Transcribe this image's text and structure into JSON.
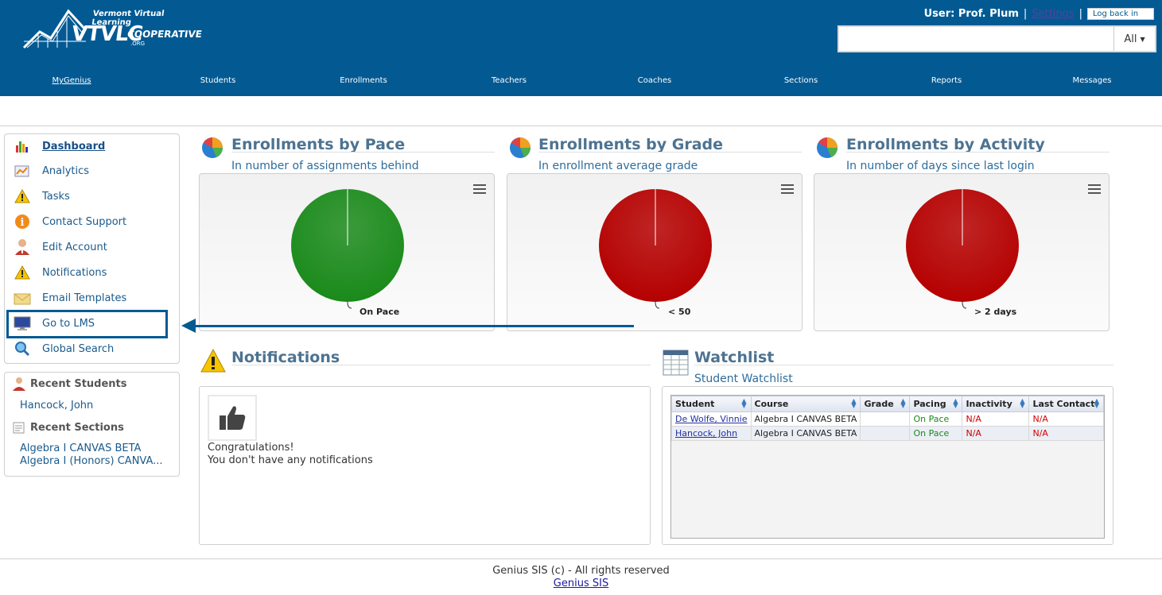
{
  "logo": {
    "line1": "Vermont Virtual Learning",
    "abbr": "VTVLC",
    "line2": "COOPERATIVE",
    "domain": ".ORG"
  },
  "userbar": {
    "user_label": "User: Prof. Plum",
    "sep1": "|",
    "settings": "Settings",
    "sep2": "|",
    "login_btn": "Log back in"
  },
  "search": {
    "value": "",
    "scope": "All"
  },
  "nav": {
    "items": [
      "MyGenius",
      "Students",
      "Enrollments",
      "Teachers",
      "Coaches",
      "Sections",
      "Reports",
      "Messages"
    ],
    "active": "MyGenius"
  },
  "sidebar": {
    "items": [
      {
        "label": "Dashboard",
        "icon": "dashboard-icon"
      },
      {
        "label": "Analytics",
        "icon": "analytics-icon"
      },
      {
        "label": "Tasks",
        "icon": "warning-icon"
      },
      {
        "label": "Contact Support",
        "icon": "info-icon"
      },
      {
        "label": "Edit Account",
        "icon": "user-icon"
      },
      {
        "label": "Notifications",
        "icon": "warning-icon"
      },
      {
        "label": "Email Templates",
        "icon": "envelope-icon"
      },
      {
        "label": "Go to LMS",
        "icon": "monitor-icon"
      },
      {
        "label": "Global Search",
        "icon": "magnifier-icon"
      }
    ]
  },
  "recent": {
    "students_title": "Recent Students",
    "students": [
      "Hancock, John"
    ],
    "sections_title": "Recent Sections",
    "sections": [
      "Algebra I CANVAS BETA",
      "Algebra I (Honors) CANVA..."
    ]
  },
  "widgets": {
    "pace": {
      "title": "Enrollments by Pace",
      "subtitle": "In number of assignments behind"
    },
    "grade": {
      "title": "Enrollments by Grade",
      "subtitle": "In enrollment average grade"
    },
    "activity": {
      "title": "Enrollments by Activity",
      "subtitle": "In number of days since last login"
    }
  },
  "chart_data": [
    {
      "type": "pie",
      "slices": [
        {
          "label": "On Pace",
          "value": 100,
          "color": "#1a8a1a"
        }
      ]
    },
    {
      "type": "pie",
      "slices": [
        {
          "label": "< 50",
          "value": 100,
          "color": "#b50000"
        }
      ]
    },
    {
      "type": "pie",
      "slices": [
        {
          "label": "> 2 days",
          "value": 100,
          "color": "#b50000"
        }
      ]
    }
  ],
  "notifications": {
    "title": "Notifications",
    "line1": "Congratulations!",
    "line2": "You don't have any notifications"
  },
  "watchlist": {
    "title": "Watchlist",
    "subtitle": "Student Watchlist",
    "columns": [
      "Student",
      "Course",
      "Grade",
      "Pacing",
      "Inactivity",
      "Last Contact"
    ],
    "rows": [
      {
        "student": "De Wolfe, Vinnie",
        "course": "Algebra I CANVAS BETA",
        "grade": "",
        "pacing": "On Pace",
        "inactivity": "N/A",
        "last_contact": "N/A"
      },
      {
        "student": "Hancock, John",
        "course": "Algebra I CANVAS BETA",
        "grade": "",
        "pacing": "On Pace",
        "inactivity": "N/A",
        "last_contact": "N/A"
      }
    ]
  },
  "footer": {
    "copyright": "Genius SIS (c) - All rights reserved",
    "link": "Genius SIS"
  }
}
